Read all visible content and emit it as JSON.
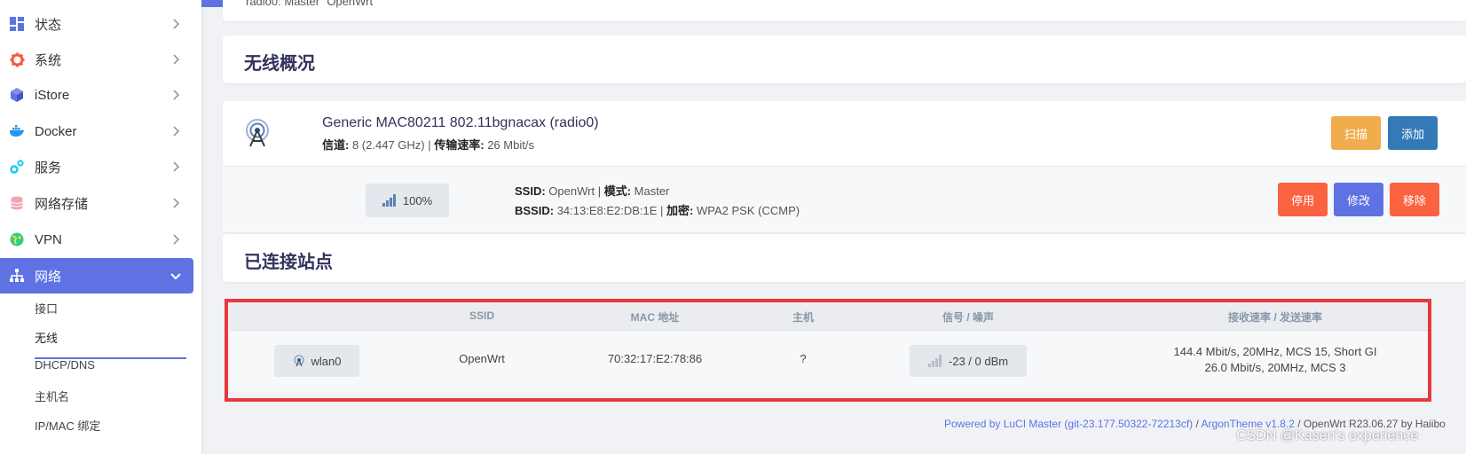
{
  "sidebar": {
    "items": [
      {
        "label": "状态",
        "icon": "dashboard-icon",
        "color": "#5e72e4"
      },
      {
        "label": "系统",
        "icon": "gear-icon",
        "color": "#f5593d"
      },
      {
        "label": "iStore",
        "icon": "cube-icon",
        "color": "#5e72e4"
      },
      {
        "label": "Docker",
        "icon": "docker-whale-icon",
        "color": "#2496ed"
      },
      {
        "label": "服务",
        "icon": "services-icon",
        "color": "#11cdef"
      },
      {
        "label": "网络存储",
        "icon": "database-icon",
        "color": "#f3a4b5"
      },
      {
        "label": "VPN",
        "icon": "globe-icon",
        "color": "#2dce89"
      },
      {
        "label": "网络",
        "icon": "network-tree-icon",
        "color": "#ffffff"
      }
    ],
    "sub_items": [
      "接口",
      "无线",
      "DHCP/DNS",
      "主机名",
      "IP/MAC 绑定"
    ],
    "current_sub": "无线",
    "accent": "#5e72e4"
  },
  "top_card": {
    "text": "radio0: Master \"OpenWrt\""
  },
  "wireless_overview": {
    "title": "无线概况",
    "radio": {
      "name": "Generic MAC80211 802.11bgnacax (radio0)",
      "channel_label": "信道:",
      "channel_value": "8 (2.447 GHz)",
      "rate_label": "传输速率:",
      "rate_value": "26 Mbit/s",
      "scan_label": "扫描",
      "add_label": "添加"
    },
    "network": {
      "signal": "100%",
      "ssid_label": "SSID:",
      "ssid_value": "OpenWrt",
      "mode_label": "模式:",
      "mode_value": "Master",
      "bssid_label": "BSSID:",
      "bssid_value": "34:13:E8:E2:DB:1E",
      "enc_label": "加密:",
      "enc_value": "WPA2 PSK (CCMP)",
      "disable_label": "停用",
      "edit_label": "修改",
      "remove_label": "移除"
    }
  },
  "stations": {
    "title": "已连接站点",
    "headers": [
      "SSID",
      "MAC 地址",
      "主机",
      "信号 / 噪声",
      "接收速率 / 发送速率"
    ],
    "row": {
      "iface": "wlan0",
      "ssid": "OpenWrt",
      "mac": "70:32:17:E2:78:86",
      "host": "?",
      "signal": "-23 / 0 dBm",
      "rx_rate": "144.4 Mbit/s, 20MHz, MCS 15, Short GI",
      "tx_rate": "26.0 Mbit/s, 20MHz, MCS 3"
    }
  },
  "footer": {
    "luci": "Powered by LuCI Master (git-23.177.50322-72213cf)",
    "sep1": " / ",
    "theme": "ArgonTheme v1.8.2",
    "rest": " / OpenWrt R23.06.27 by Haiibo"
  },
  "watermark": "CSDN @Kasen's experience",
  "colors": {
    "primary": "#5e72e4",
    "warning": "#f0ad4e",
    "info": "#337ab7",
    "danger": "#fb6340",
    "highlight": "#e8383d"
  }
}
